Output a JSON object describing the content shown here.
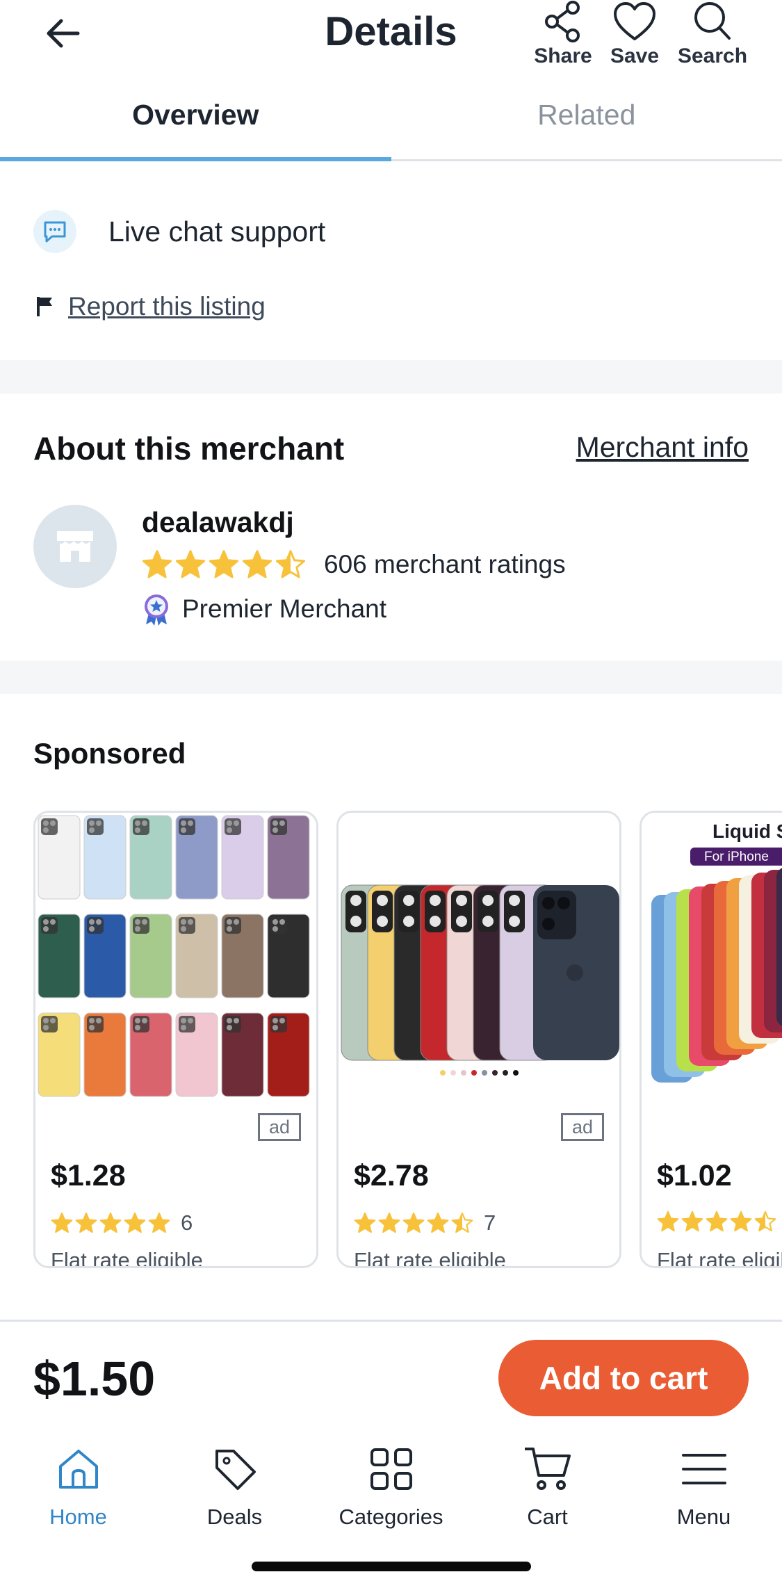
{
  "header": {
    "title": "Details",
    "actions": [
      {
        "label": "Share",
        "icon": "share-icon"
      },
      {
        "label": "Save",
        "icon": "heart-icon"
      },
      {
        "label": "Search",
        "icon": "search-icon"
      }
    ]
  },
  "tabs": [
    {
      "label": "Overview",
      "active": true
    },
    {
      "label": "Related",
      "active": false
    }
  ],
  "support": {
    "live_chat": "Live chat support",
    "report_link": "Report this listing"
  },
  "merchant": {
    "heading": "About this merchant",
    "info_link": "Merchant info",
    "name": "dealawakdj",
    "rating": 4.5,
    "ratings_text": "606 merchant ratings",
    "badge_text": "Premier Merchant"
  },
  "sponsored": {
    "heading": "Sponsored",
    "items": [
      {
        "price": "$1.28",
        "rating": 5,
        "rating_count": "6",
        "shipping": "Flat rate eligible",
        "ad_label": "ad"
      },
      {
        "price": "$2.78",
        "rating": 4.5,
        "rating_count": "7",
        "shipping": "Flat rate eligible",
        "ad_label": "ad"
      },
      {
        "price": "$1.02",
        "rating": 4.5,
        "rating_count": "",
        "shipping": "Flat rate eligible",
        "ad_label": "",
        "image_text": "Liquid S",
        "image_subtext": "For iPhone"
      }
    ]
  },
  "buy_bar": {
    "price": "$1.50",
    "button": "Add to cart"
  },
  "bottom_nav": [
    {
      "label": "Home",
      "icon": "home-icon",
      "active": true
    },
    {
      "label": "Deals",
      "icon": "tag-icon",
      "active": false
    },
    {
      "label": "Categories",
      "icon": "grid-icon",
      "active": false
    },
    {
      "label": "Cart",
      "icon": "cart-icon",
      "active": false
    },
    {
      "label": "Menu",
      "icon": "menu-icon",
      "active": false
    }
  ],
  "colors": {
    "accent": "#5aa8e0",
    "brand_button": "#ea5c33",
    "star": "#f7c23a",
    "nav_active": "#2f86c8"
  }
}
